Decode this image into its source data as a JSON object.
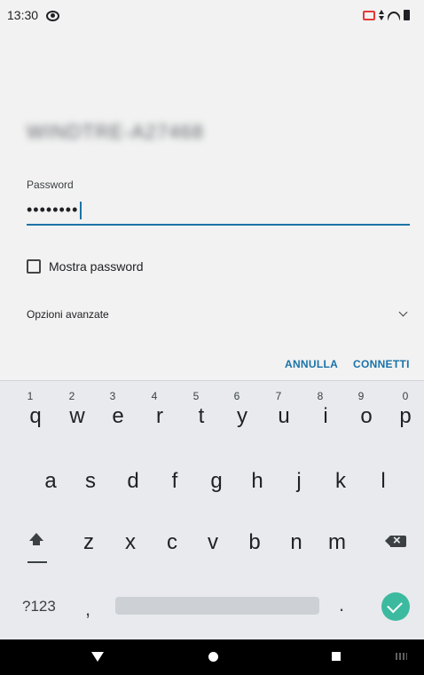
{
  "status_bar": {
    "time": "13:30"
  },
  "dialog": {
    "network_name": "WINDTRE-A27468",
    "password_label": "Password",
    "password_value": "••••••••",
    "show_password_label": "Mostra password",
    "advanced_options_label": "Opzioni avanzate",
    "cancel_label": "ANNULLA",
    "connect_label": "CONNETTI"
  },
  "keyboard": {
    "row1": [
      {
        "key": "q",
        "num": "1"
      },
      {
        "key": "w",
        "num": "2"
      },
      {
        "key": "e",
        "num": "3"
      },
      {
        "key": "r",
        "num": "4"
      },
      {
        "key": "t",
        "num": "5"
      },
      {
        "key": "y",
        "num": "6"
      },
      {
        "key": "u",
        "num": "7"
      },
      {
        "key": "i",
        "num": "8"
      },
      {
        "key": "o",
        "num": "9"
      },
      {
        "key": "p",
        "num": "0"
      }
    ],
    "row2": [
      "a",
      "s",
      "d",
      "f",
      "g",
      "h",
      "j",
      "k",
      "l"
    ],
    "row3": [
      "z",
      "x",
      "c",
      "v",
      "b",
      "n",
      "m"
    ],
    "symbols_label": "?123",
    "comma_label": ",",
    "period_label": "."
  },
  "colors": {
    "accent": "#1a73a8",
    "enter_key": "#3cba9f",
    "keyboard_bg": "#e8eaed"
  }
}
